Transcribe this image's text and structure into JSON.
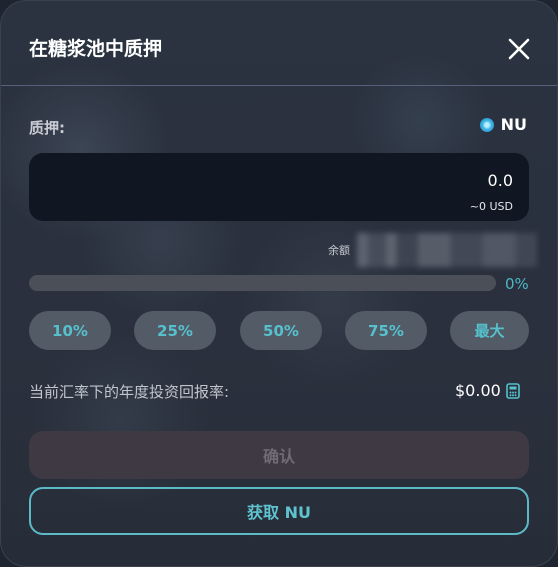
{
  "modal": {
    "title": "在糖浆池中质押",
    "close_icon": "close-icon"
  },
  "stake": {
    "label": "质押:",
    "token_symbol": "NU",
    "token_icon": "nu-token-icon",
    "amount": "0.0",
    "usd_value": "~0 USD",
    "balance_label": "余额"
  },
  "slider": {
    "percent_label": "0%",
    "value": 0
  },
  "percent_buttons": [
    "10%",
    "25%",
    "50%",
    "75%",
    "最大"
  ],
  "apr": {
    "label": "当前汇率下的年度投资回报率:",
    "value": "$0.00",
    "icon": "calculator-icon"
  },
  "actions": {
    "confirm_label": "确认",
    "get_token_label": "获取 NU"
  },
  "colors": {
    "accent": "#56c1cd",
    "modal_bg": "#2a303d",
    "input_bg": "#111722",
    "disabled_button": "#3f3944"
  }
}
